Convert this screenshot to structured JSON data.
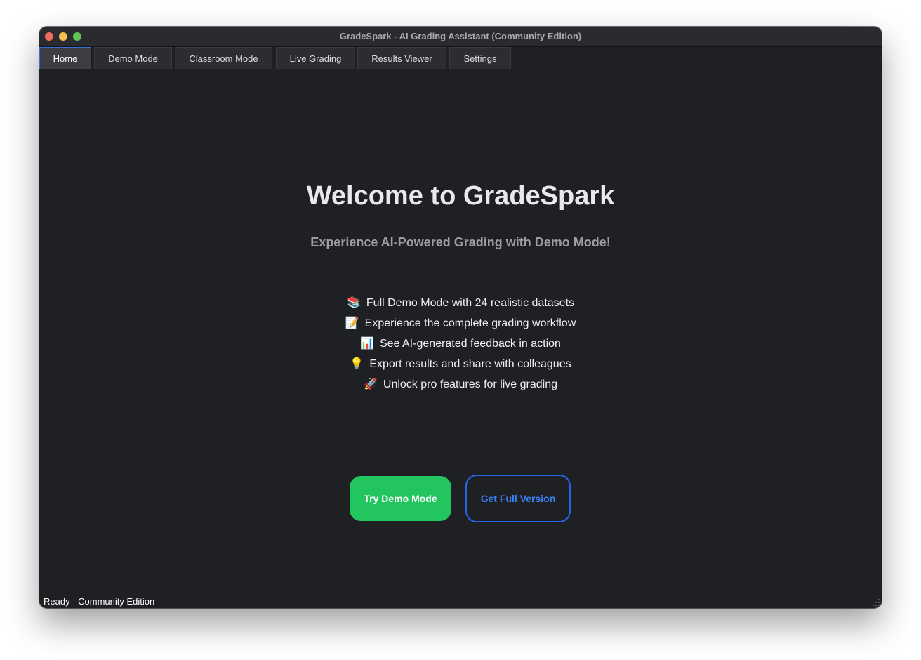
{
  "window": {
    "title": "GradeSpark - AI Grading Assistant (Community Edition)"
  },
  "tabs": [
    {
      "label": "Home",
      "active": true
    },
    {
      "label": "Demo Mode",
      "active": false
    },
    {
      "label": "Classroom Mode",
      "active": false
    },
    {
      "label": "Live Grading",
      "active": false
    },
    {
      "label": "Results Viewer",
      "active": false
    },
    {
      "label": "Settings",
      "active": false
    }
  ],
  "home": {
    "heading": "Welcome to GradeSpark",
    "subtitle": "Experience AI-Powered Grading with Demo Mode!",
    "features": [
      {
        "icon": "📚",
        "icon_name": "books-icon",
        "text": "Full Demo Mode with 24 realistic datasets"
      },
      {
        "icon": "📝",
        "icon_name": "memo-icon",
        "text": "Experience the complete grading workflow"
      },
      {
        "icon": "📊",
        "icon_name": "bar-chart-icon",
        "text": "See AI-generated feedback in action"
      },
      {
        "icon": "💡",
        "icon_name": "light-bulb-icon",
        "text": "Export results and share with colleagues"
      },
      {
        "icon": "🚀",
        "icon_name": "rocket-icon",
        "text": "Unlock pro features for live grading"
      }
    ],
    "primary_button": "Try Demo Mode",
    "secondary_button": "Get Full Version"
  },
  "status": {
    "text": "Ready - Community Edition"
  },
  "colors": {
    "window_bg": "#1f2024",
    "primary_green": "#22c55e",
    "accent_blue": "#2563eb",
    "active_tab_border": "#3b6fd8"
  }
}
